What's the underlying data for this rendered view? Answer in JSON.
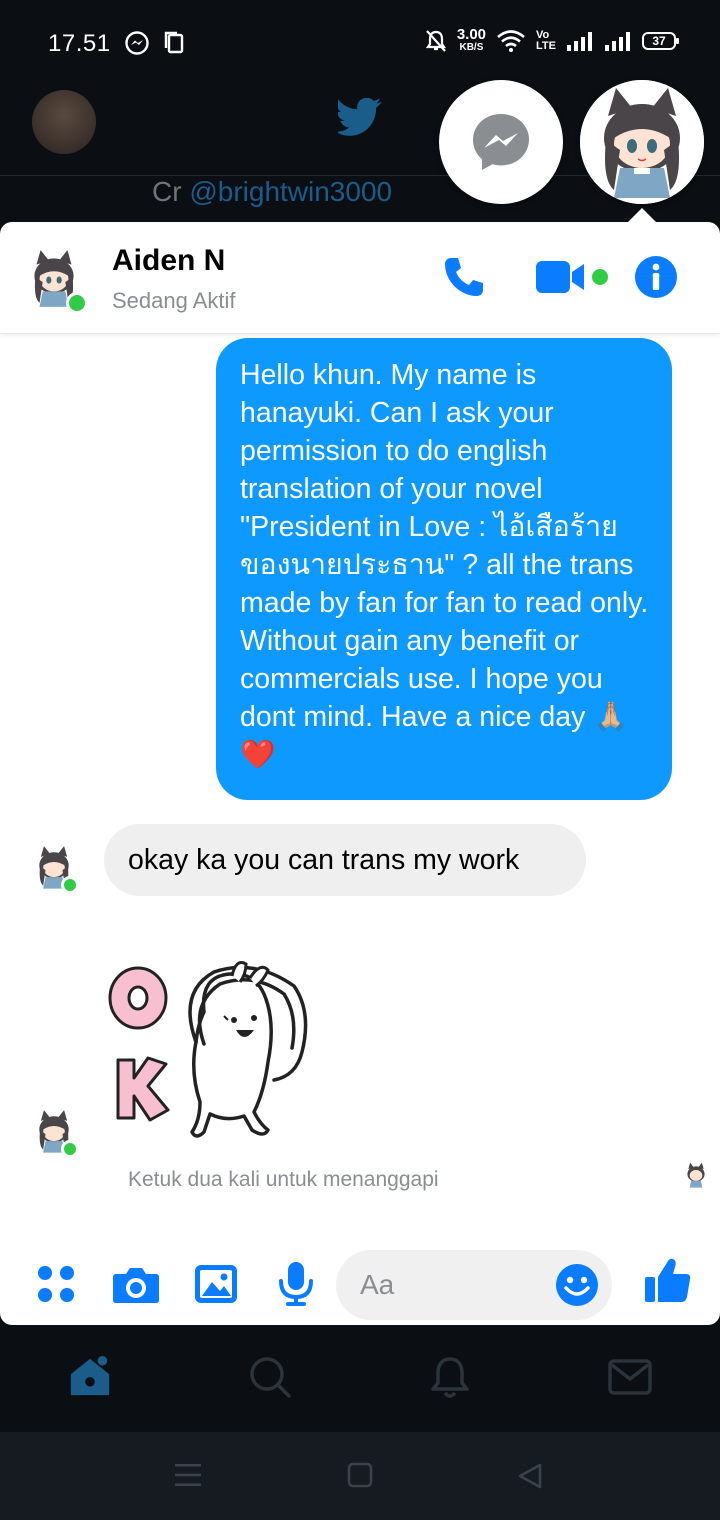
{
  "status_bar": {
    "time": "17.51",
    "net_speed_value": "3.00",
    "net_speed_unit": "KB/S",
    "volte": "Vo\nLTE",
    "battery": "37"
  },
  "background_app": {
    "credit_prefix": "Cr ",
    "credit_handle": "@brightwin3000"
  },
  "chat": {
    "contact_name": "Aiden N",
    "contact_status": "Sedang Aktif",
    "messages": [
      {
        "direction": "outgoing",
        "text": "Hello khun. My name is hanayuki. Can I ask your permission to do english translation of your novel \"President in Love : ไอ้เสือร้ายของนายประธาน\" ? all the trans made by fan for fan to read only. Without gain any benefit or commercials use. I hope you dont mind. Have a nice day 🙏🏼❤️"
      },
      {
        "direction": "incoming",
        "text": "okay ka you can trans my work"
      },
      {
        "direction": "incoming",
        "sticker": "OK"
      }
    ],
    "reply_hint": "Ketuk dua kali untuk menanggapi",
    "composer_placeholder": "Aa"
  },
  "icons": {
    "header": [
      "phone-icon",
      "video-call-icon",
      "info-icon"
    ],
    "composer": [
      "menu-dots-icon",
      "camera-icon",
      "gallery-icon",
      "microphone-icon",
      "emoji-icon",
      "like-icon"
    ],
    "bottom_nav": [
      "home-icon",
      "search-icon",
      "notifications-icon",
      "messages-icon"
    ],
    "system_nav": [
      "recents-icon",
      "home-button-icon",
      "back-icon"
    ]
  },
  "colors": {
    "messenger_blue": "#0d99ff",
    "accent_blue": "#0a7cff",
    "online_green": "#31cc46",
    "incoming_bubble": "#efefef"
  }
}
